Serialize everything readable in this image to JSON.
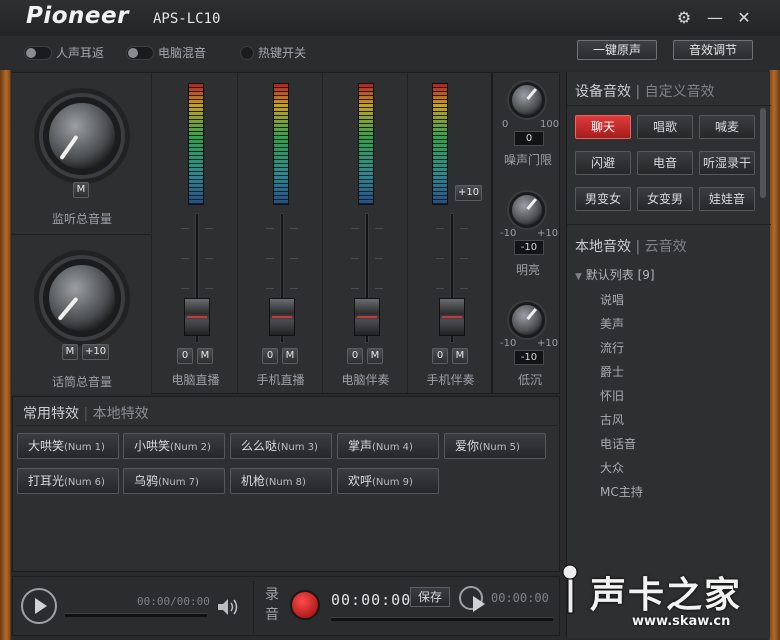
{
  "title": {
    "brand": "Pioneer",
    "model": "APS-LC10"
  },
  "window": {
    "settings_icon": "gear-icon",
    "min_icon": "minimize-icon",
    "close_icon": "close-icon"
  },
  "toggles": [
    {
      "label": "人声耳返"
    },
    {
      "label": "电脑混音"
    },
    {
      "label": "热键开关"
    }
  ],
  "header_buttons": {
    "reset": "一键原声",
    "sound_adjust": "音效调节"
  },
  "monitor": {
    "label": "监听总音量",
    "m_label": "M"
  },
  "mic": {
    "label": "话筒总音量",
    "m_label": "M",
    "plus10": "+10"
  },
  "channels": [
    {
      "label": "电脑直播",
      "zero": "0",
      "m": "M"
    },
    {
      "label": "手机直播",
      "zero": "0",
      "m": "M"
    },
    {
      "label": "电脑伴奏",
      "zero": "0",
      "m": "M"
    },
    {
      "label": "手机伴奏",
      "zero": "0",
      "m": "M",
      "plus10": "+10"
    }
  ],
  "noise_gate": {
    "label": "噪声门限",
    "min": "0",
    "max": "100",
    "value": "0"
  },
  "bright": {
    "label": "明亮",
    "min": "-10",
    "max": "+10",
    "value": "-10"
  },
  "low": {
    "label": "低沉",
    "min": "-10",
    "max": "+10",
    "value": "-10"
  },
  "fx": {
    "tab_active": "常用特效",
    "tab_other": "本地特效",
    "buttons": [
      {
        "label": "大哄笑",
        "key": "(Num 1)"
      },
      {
        "label": "小哄笑",
        "key": "(Num 2)"
      },
      {
        "label": "么么哒",
        "key": "(Num 3)"
      },
      {
        "label": "掌声",
        "key": "(Num 4)"
      },
      {
        "label": "爱你",
        "key": "(Num 5)"
      },
      {
        "label": "打耳光",
        "key": "(Num 6)"
      },
      {
        "label": "乌鸦",
        "key": "(Num 7)"
      },
      {
        "label": "机枪",
        "key": "(Num 8)"
      },
      {
        "label": "欢呼",
        "key": "(Num 9)"
      }
    ]
  },
  "device_effects": {
    "tab_active": "设备音效",
    "tab_other": "自定义音效",
    "buttons": [
      "聊天",
      "唱歌",
      "喊麦",
      "闪避",
      "电音",
      "听湿录干",
      "男变女",
      "女变男",
      "娃娃音"
    ],
    "active_index": 0
  },
  "local_effects": {
    "tab_active": "本地音效",
    "tab_other": "云音效",
    "root": "默认列表 [9]",
    "items": [
      "说唱",
      "美声",
      "流行",
      "爵士",
      "怀旧",
      "古风",
      "电话音",
      "大众",
      "MC主持"
    ]
  },
  "player": {
    "time": "00:00/00:00",
    "play_icon": "play-icon",
    "volume_icon": "speaker-icon"
  },
  "recorder": {
    "label_top": "录",
    "label_bottom": "音",
    "time": "00:00:00",
    "save": "保存",
    "play_time": "00:00:00"
  },
  "watermark": {
    "text": "声卡之家",
    "url": "www.skaw.cn"
  }
}
